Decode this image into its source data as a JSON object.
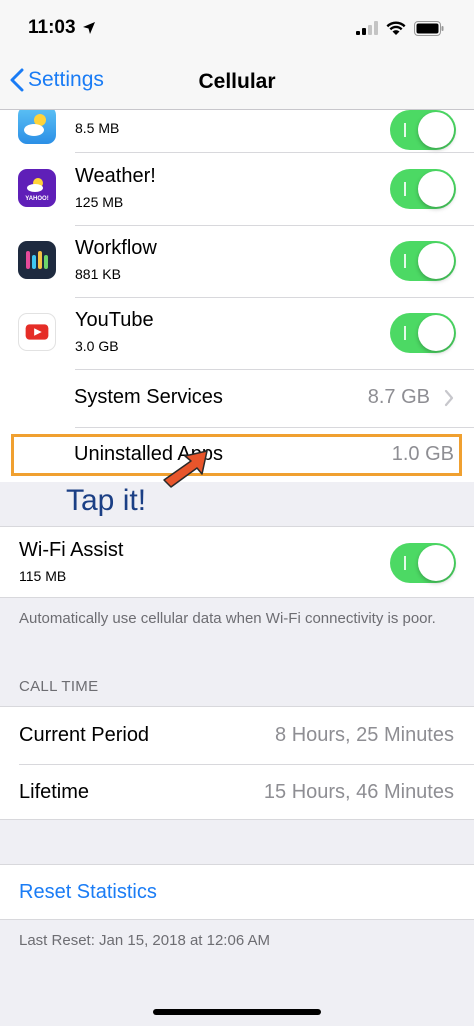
{
  "status_bar": {
    "time": "11:03"
  },
  "nav": {
    "back_label": "Settings",
    "title": "Cellular"
  },
  "apps": [
    {
      "name": "Weather",
      "size": "8.5 MB",
      "icon": "weather-icon",
      "toggle_on": true
    },
    {
      "name": "Weather!",
      "size": "125 MB",
      "icon": "yahoo-weather-icon",
      "toggle_on": true
    },
    {
      "name": "Workflow",
      "size": "881 KB",
      "icon": "workflow-icon",
      "toggle_on": true
    },
    {
      "name": "YouTube",
      "size": "3.0 GB",
      "icon": "youtube-icon",
      "toggle_on": true
    }
  ],
  "system_services": {
    "label": "System Services",
    "value": "8.7 GB"
  },
  "uninstalled_apps": {
    "label": "Uninstalled Apps",
    "value": "1.0 GB"
  },
  "annotation": {
    "text": "Tap it!",
    "color": "#1b3f85",
    "box_color": "#f0a030",
    "arrow_color": "#e8552b"
  },
  "wifi_assist": {
    "label": "Wi-Fi Assist",
    "size": "115 MB",
    "toggle_on": true,
    "footer": "Automatically use cellular data when Wi-Fi connectivity is poor."
  },
  "call_time": {
    "header": "CALL TIME",
    "current_period": {
      "label": "Current Period",
      "value": "8 Hours, 25 Minutes"
    },
    "lifetime": {
      "label": "Lifetime",
      "value": "15 Hours, 46 Minutes"
    }
  },
  "reset": {
    "label": "Reset Statistics",
    "last_reset": "Last Reset: Jan 15, 2018 at 12:06 AM"
  },
  "colors": {
    "accent": "#1a7cf5",
    "toggle_on": "#4cd964",
    "secondary_text": "#8e8e93"
  },
  "yahoo_text": "YAHOO!"
}
